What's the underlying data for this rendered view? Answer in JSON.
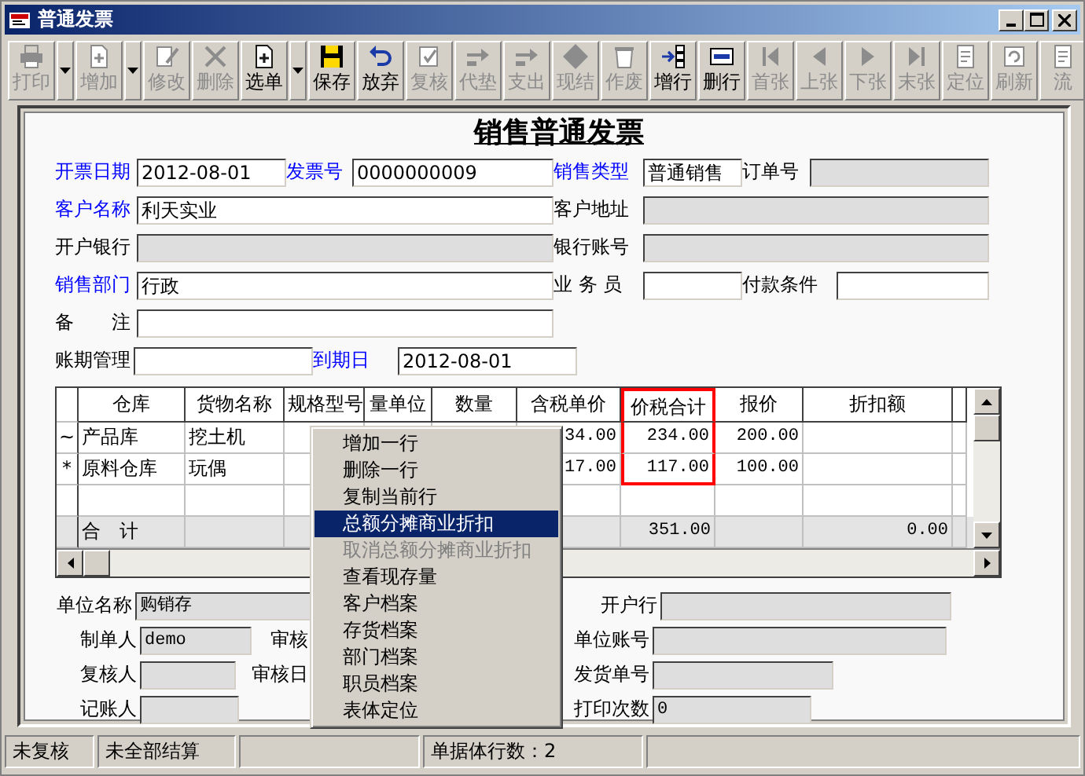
{
  "window": {
    "title": "普通发票"
  },
  "toolbar": [
    {
      "kind": "button",
      "label": "打印",
      "disabled": true
    },
    {
      "kind": "dropdown",
      "disabled": false
    },
    {
      "kind": "button",
      "label": "增加",
      "disabled": true
    },
    {
      "kind": "dropdown",
      "disabled": false
    },
    {
      "kind": "button",
      "label": "修改",
      "disabled": true
    },
    {
      "kind": "button",
      "label": "删除",
      "disabled": true
    },
    {
      "kind": "button",
      "label": "选单",
      "disabled": false
    },
    {
      "kind": "dropdown",
      "disabled": false
    },
    {
      "kind": "button",
      "label": "保存",
      "disabled": false
    },
    {
      "kind": "button",
      "label": "放弃",
      "disabled": false
    },
    {
      "kind": "button",
      "label": "复核",
      "disabled": true
    },
    {
      "kind": "button",
      "label": "代垫",
      "disabled": true
    },
    {
      "kind": "button",
      "label": "支出",
      "disabled": true
    },
    {
      "kind": "button",
      "label": "现结",
      "disabled": true
    },
    {
      "kind": "button",
      "label": "作废",
      "disabled": true
    },
    {
      "kind": "button",
      "label": "增行",
      "disabled": false
    },
    {
      "kind": "button",
      "label": "删行",
      "disabled": false
    },
    {
      "kind": "button",
      "label": "首张",
      "disabled": true
    },
    {
      "kind": "button",
      "label": "上张",
      "disabled": true
    },
    {
      "kind": "button",
      "label": "下张",
      "disabled": true
    },
    {
      "kind": "button",
      "label": "末张",
      "disabled": true
    },
    {
      "kind": "button",
      "label": "定位",
      "disabled": true
    },
    {
      "kind": "button",
      "label": "刷新",
      "disabled": true
    },
    {
      "kind": "button",
      "label": "流",
      "disabled": true
    }
  ],
  "form_title": "销售普通发票",
  "header_rows": [
    [
      {
        "label": "开票日期",
        "required": true,
        "value": "2012-08-01",
        "disabled": false
      },
      {
        "label": "发票号",
        "required": true,
        "value": "0000000009",
        "disabled": false
      },
      {
        "label": "销售类型",
        "required": true,
        "value": "普通销售",
        "disabled": false
      },
      {
        "label": "订单号",
        "required": false,
        "disabled": true
      }
    ],
    [
      {
        "label": "客户名称",
        "required": true,
        "value": "利天实业",
        "disabled": false
      },
      {
        "label": "客户地址",
        "required": false,
        "disabled": true
      }
    ],
    [
      {
        "label": "开户银行",
        "required": false,
        "disabled": true
      },
      {
        "label": "银行账号",
        "required": false,
        "disabled": true
      }
    ],
    [
      {
        "label": "销售部门",
        "required": true,
        "value": "行政",
        "disabled": false
      },
      {
        "label": "业 务 员",
        "required": false,
        "disabled": false
      },
      {
        "label": "付款条件",
        "required": false,
        "disabled": false
      }
    ],
    [
      {
        "label": "备　　注",
        "required": false,
        "disabled": false
      }
    ],
    [
      {
        "label": "账期管理",
        "required": false,
        "disabled": false
      },
      {
        "label": "到期日",
        "required": true,
        "value": "2012-08-01",
        "disabled": false
      }
    ]
  ],
  "table": {
    "columns": [
      {
        "label": "仓库",
        "highlighted": false
      },
      {
        "label": "货物名称",
        "highlighted": false
      },
      {
        "label": "规格型号",
        "highlighted": false
      },
      {
        "label": "量单位",
        "highlighted": false
      },
      {
        "label": "数量",
        "highlighted": false
      },
      {
        "label": "含税单价",
        "highlighted": false
      },
      {
        "label": "价税合计",
        "highlighted": true
      },
      {
        "label": "报价",
        "highlighted": false
      },
      {
        "label": "折扣额",
        "highlighted": false
      },
      {
        "highlighted": false
      }
    ],
    "rows": [
      {
        "marker": "~",
        "cells": [
          "产品库",
          "挖土机",
          null,
          null,
          null,
          "34.00",
          "234.00",
          "200.00",
          null,
          null
        ]
      },
      {
        "marker": "*",
        "cells": [
          "原料仓库",
          "玩偶",
          null,
          null,
          null,
          "17.00",
          "117.00",
          "100.00",
          null,
          null
        ]
      },
      {
        "cells": [
          null,
          null,
          null,
          null,
          null,
          null,
          null,
          null,
          null,
          null
        ]
      }
    ],
    "total": {
      "cells": [
        "合　计",
        null,
        null,
        null,
        null,
        null,
        "351.00",
        null,
        "0.00",
        null
      ]
    }
  },
  "footer_rows": [
    {
      "left": [
        {
          "kind": "field",
          "label": "单位名称",
          "value": "购销存",
          "disabled": true
        }
      ],
      "right": [
        {
          "kind": "field",
          "label": "开户行",
          "disabled": true
        }
      ]
    },
    {
      "left": [
        {
          "kind": "field",
          "label": "制单人",
          "value": "demo",
          "disabled": true
        },
        {
          "kind": "label",
          "label": "审核"
        }
      ],
      "right": [
        {
          "kind": "field",
          "label": "单位账号",
          "disabled": true
        }
      ]
    },
    {
      "left": [
        {
          "kind": "field",
          "label": "复核人",
          "disabled": true
        },
        {
          "kind": "label",
          "label": "审核日"
        }
      ],
      "right": [
        {
          "kind": "field",
          "label": "发货单号",
          "disabled": true
        }
      ]
    },
    {
      "left": [
        {
          "kind": "field",
          "label": "记账人",
          "disabled": true
        }
      ],
      "right": [
        {
          "kind": "field",
          "label": "打印次数",
          "value": "0",
          "disabled": true
        }
      ]
    }
  ],
  "context_menu": [
    {
      "label": "增加一行",
      "selected": false,
      "disabled": false
    },
    {
      "label": "删除一行",
      "selected": false,
      "disabled": false
    },
    {
      "label": "复制当前行",
      "selected": false,
      "disabled": false
    },
    {
      "label": "总额分摊商业折扣",
      "selected": true,
      "disabled": false
    },
    {
      "label": "取消总额分摊商业折扣",
      "selected": false,
      "disabled": true
    },
    {
      "label": "查看现存量",
      "selected": false,
      "disabled": false
    },
    {
      "label": "客户档案",
      "selected": false,
      "disabled": false
    },
    {
      "label": "存货档案",
      "selected": false,
      "disabled": false
    },
    {
      "label": "部门档案",
      "selected": false,
      "disabled": false
    },
    {
      "label": "职员档案",
      "selected": false,
      "disabled": false
    },
    {
      "label": "表体定位",
      "selected": false,
      "disabled": false
    }
  ],
  "status_bar": [
    "未复核",
    "未全部结算",
    "单据体行数：2"
  ]
}
